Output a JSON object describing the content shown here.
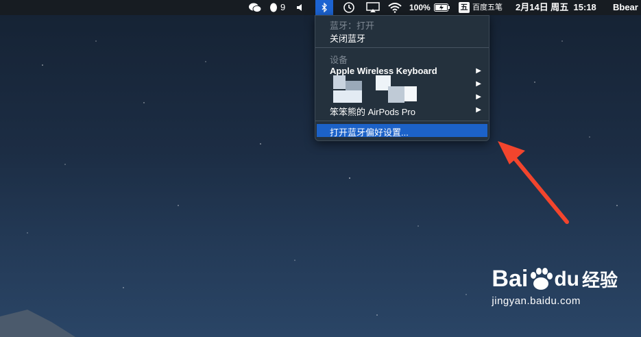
{
  "menubar": {
    "qq_count": "9",
    "battery": "100%",
    "input_method": "百度五笔",
    "input_badge": "五",
    "datetime": "2月14日 周五  15:18",
    "user": "Bbear"
  },
  "bluetooth_menu": {
    "status": "蓝牙：打开",
    "toggle": "关闭蓝牙",
    "devices_header": "设备",
    "devices": [
      {
        "name": "Apple Wireless Keyboard"
      },
      {
        "name": ""
      },
      {
        "name": ""
      },
      {
        "name": "笨笨熊的 AirPods Pro"
      }
    ],
    "open_prefs": "打开蓝牙偏好设置..."
  },
  "watermark": {
    "brand_bai": "Bai",
    "brand_du": "du",
    "brand_cn": "经验",
    "url": "jingyan.baidu.com"
  },
  "colors": {
    "menu_bg": "#24313d",
    "highlight": "#1c62c8",
    "annotation_arrow": "#f2452d",
    "menubar_bg": "#171c22"
  }
}
